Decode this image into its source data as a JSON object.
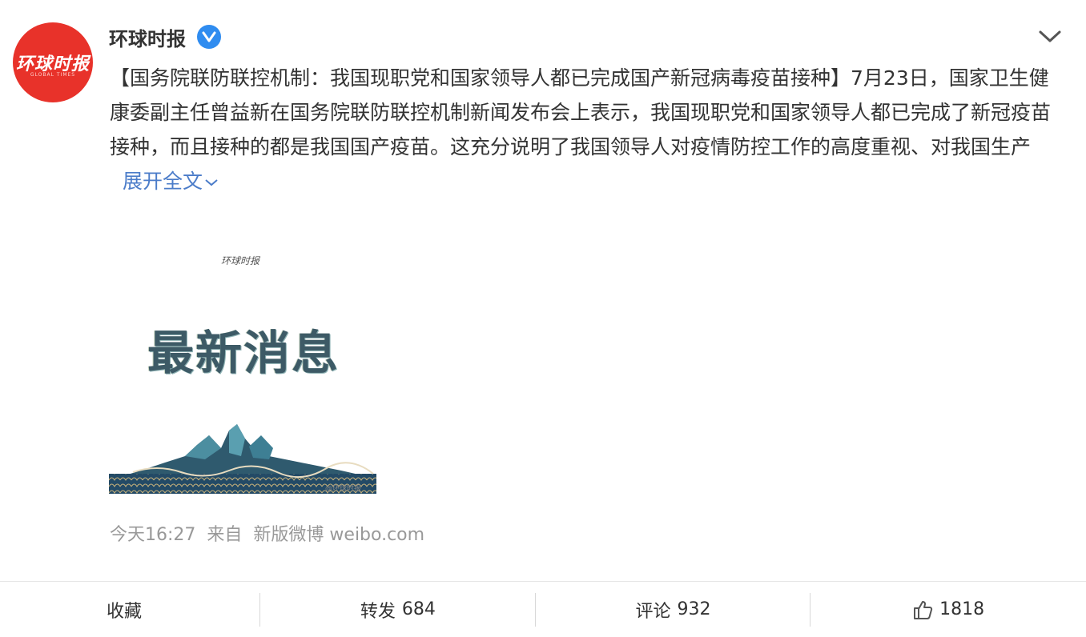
{
  "author": {
    "name": "环球时报",
    "avatar_logo": "环球时报",
    "avatar_sub": "GLOBAL TIMES",
    "verified_icon": "verified-badge-icon"
  },
  "post": {
    "text": "【国务院联防联控机制：我国现职党和国家领导人都已完成国产新冠病毒疫苗接种】7月23日，国家卫生健康委副主任曾益新在国务院联防联控机制新闻发布会上表示，我国现职党和国家领导人都已完成了新冠疫苗接种，而且接种的都是我国国产疫苗。这充分说明了我国领导人对疫情防控工作的高度重视、对我国生产",
    "expand_label": "展开全文"
  },
  "image": {
    "brand": "环球时报",
    "headline": "最新消息",
    "watermark": "@环球时报"
  },
  "meta": {
    "time": "今天16:27",
    "source_prefix": "来自",
    "source": "新版微博 weibo.com"
  },
  "actions": {
    "favorite": "收藏",
    "repost_label": "转发",
    "repost_count": "684",
    "comment_label": "评论",
    "comment_count": "932",
    "like_count": "1818"
  },
  "colors": {
    "avatar_bg": "#e8322a",
    "verified": "#2f8cf0",
    "link": "#4b7cc9",
    "meta_text": "#999999"
  }
}
